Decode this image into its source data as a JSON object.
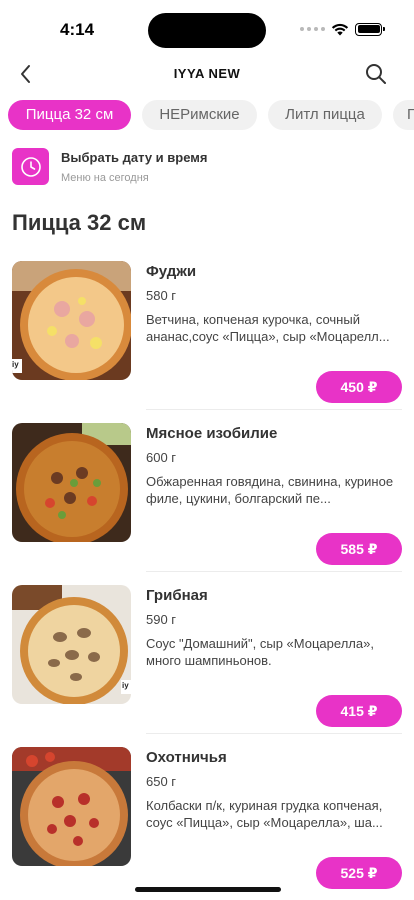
{
  "status_bar": {
    "time": "4:14"
  },
  "nav": {
    "title": "IYYA NEW"
  },
  "tabs": [
    {
      "label": "Пицца 32 см",
      "active": true
    },
    {
      "label": "НЕРимские",
      "active": false
    },
    {
      "label": "Литл пицца",
      "active": false
    },
    {
      "label": "П",
      "active": false
    }
  ],
  "schedule": {
    "title": "Выбрать дату и время",
    "subtitle": "Меню на сегодня"
  },
  "section": {
    "title": "Пицца 32 см"
  },
  "products": [
    {
      "name": "Фуджи",
      "weight": "580 г",
      "description": "Ветчина, копченая курочка, сочный ананас,соус «Пицца», сыр «Моцарелл...",
      "price": "450 ₽",
      "badge": "iy"
    },
    {
      "name": "Мясное изобилие",
      "weight": "600 г",
      "description": "Обжаренная говядина, свинина, куриное филе, цукини, болгарский пе...",
      "price": "585 ₽",
      "badge": ""
    },
    {
      "name": "Грибная",
      "weight": "590 г",
      "description": "Соус \"Домашний\", сыр «Моцарелла», много шампиньонов.",
      "price": "415 ₽",
      "badge": "iy"
    },
    {
      "name": "Охотничья",
      "weight": "650 г",
      "description": "Колбаски п/к, куриная грудка копченая, соус «Пицца», сыр «Моцарелла», ша...",
      "price": "525 ₽",
      "badge": ""
    }
  ],
  "colors": {
    "accent": "#e833c7",
    "chip_bg": "#f1f1f1",
    "text": "#333333"
  }
}
